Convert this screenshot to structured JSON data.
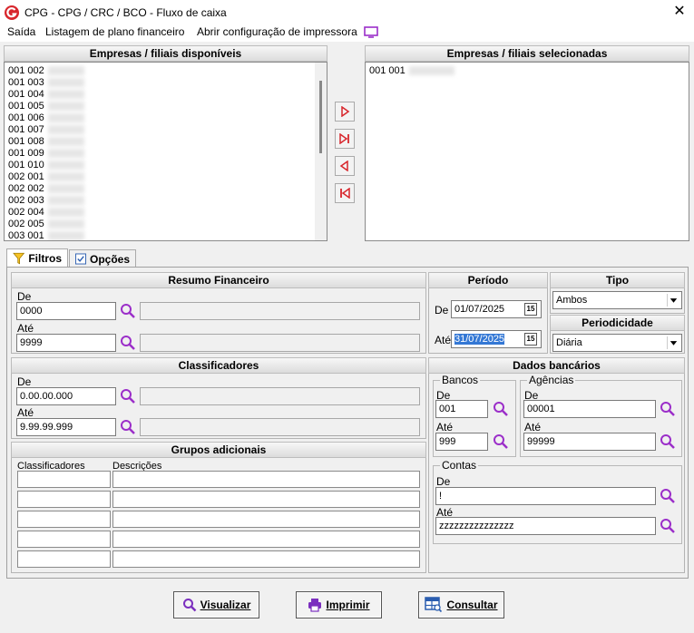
{
  "window": {
    "title": "CPG - CPG / CRC / BCO - Fluxo de caixa",
    "close_glyph": "✕"
  },
  "menu": [
    "Saída",
    "Listagem de plano financeiro",
    "Abrir configuração de impressora"
  ],
  "available": {
    "header": "Empresas / filiais disponíveis",
    "items": [
      "001 002",
      "001 003",
      "001 004",
      "001 005",
      "001 006",
      "001 007",
      "001 008",
      "001 009",
      "001 010",
      "002 001",
      "002 002",
      "002 003",
      "002 004",
      "002 005",
      "003 001"
    ]
  },
  "selected": {
    "header": "Empresas / filiais selecionadas",
    "items": [
      "001 001"
    ]
  },
  "tabs": [
    {
      "label": "Filtros",
      "icon": "filter-icon",
      "active": true
    },
    {
      "label": "Opções",
      "icon": "checkbox-icon",
      "active": false
    }
  ],
  "resumo": {
    "header": "Resumo Financeiro",
    "de_label": "De",
    "de_value": "0000",
    "ate_label": "Até",
    "ate_value": "9999"
  },
  "classificadores": {
    "header": "Classificadores",
    "de_label": "De",
    "de_value": "0.00.00.000",
    "ate_label": "Até",
    "ate_value": "9.99.99.999"
  },
  "grupos": {
    "header": "Grupos adicionais",
    "col1": "Classificadores",
    "col2": "Descrições",
    "rows": 5
  },
  "periodo": {
    "header": "Período",
    "de_label": "De",
    "de_value": "01/07/2025",
    "ate_label": "Até",
    "ate_value": "31/07/2025",
    "cal_glyph": "15"
  },
  "tipo": {
    "header": "Tipo",
    "value": "Ambos"
  },
  "periodicidade": {
    "header": "Periodicidade",
    "value": "Diária"
  },
  "dados_bancarios": {
    "header": "Dados bancários",
    "bancos": {
      "legend": "Bancos",
      "de_label": "De",
      "de_value": "001",
      "ate_label": "Até",
      "ate_value": "999"
    },
    "agencias": {
      "legend": "Agências",
      "de_label": "De",
      "de_value": "00001",
      "ate_label": "Até",
      "ate_value": "99999"
    },
    "contas": {
      "legend": "Contas",
      "de_label": "De",
      "de_value": "!",
      "ate_label": "Até",
      "ate_value": "zzzzzzzzzzzzzzz"
    }
  },
  "buttons": {
    "visualizar": "Visualizar",
    "imprimir": "Imprimir",
    "consultar": "Consultar"
  },
  "colors": {
    "accent_purple": "#7b2fbf",
    "move_red": "#d8262c",
    "selection_blue": "#3478d5"
  }
}
